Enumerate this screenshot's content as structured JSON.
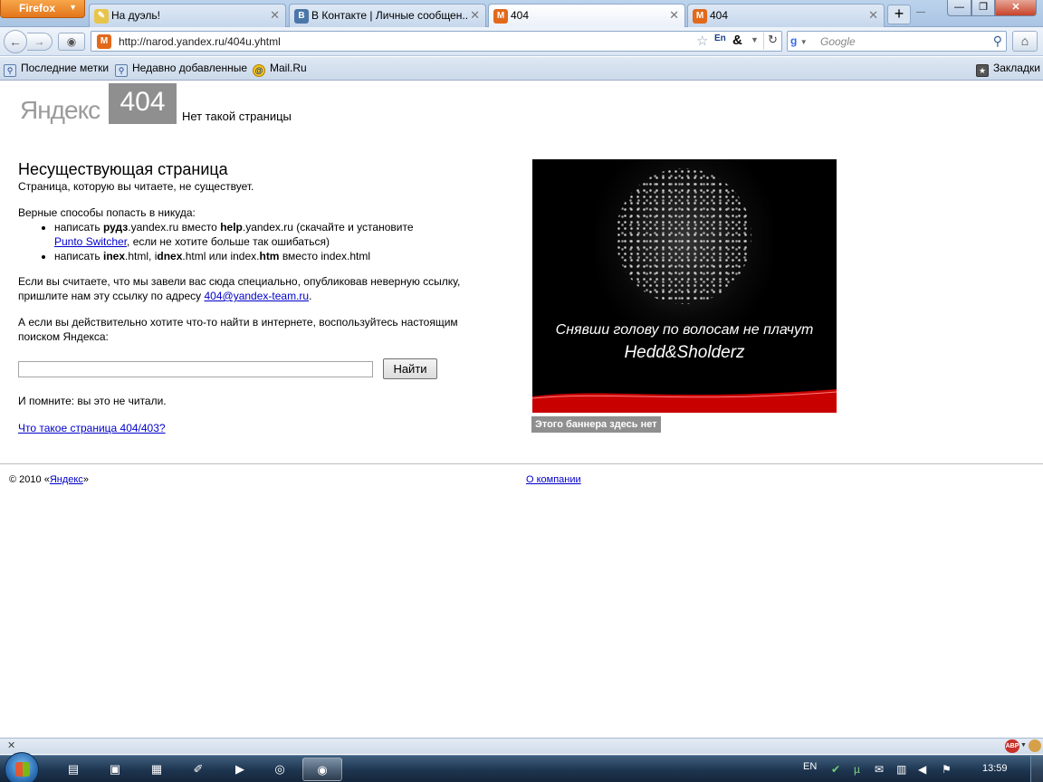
{
  "browser": {
    "menu_button": "Firefox",
    "tabs": [
      {
        "title": "На дуэль!",
        "favicon": "duel-favicon"
      },
      {
        "title": "В Контакте | Личные сообщен...",
        "favicon": "vk-favicon"
      },
      {
        "title": "404",
        "favicon": "narod-favicon",
        "active": true
      },
      {
        "title": "404",
        "favicon": "narod-favicon"
      }
    ],
    "url": "http://narod.yandex.ru/404u.yhtml",
    "search_engine": "google",
    "search_placeholder": "Google",
    "bookmarks": [
      "Последние метки",
      "Недавно добавленные",
      "Mail.Ru"
    ],
    "bookmarks_menu": "Закладки"
  },
  "page": {
    "logo": "Яндекс",
    "error_code": "404",
    "error_text": "Нет такой страницы",
    "heading": "Несуществующая страница",
    "subheading": "Страница, которую вы читаете, не существует.",
    "ways_heading": "Верные способы попасть в никуда:",
    "way1": {
      "before": "написать ",
      "bold1": "рудз",
      "mid": ".yandex.ru вместо ",
      "bold2": "help",
      "after": ".yandex.ru (скачайте и установите",
      "link": "Punto Switcher",
      "tail": ", если не хотите больше так ошибаться)"
    },
    "way2": {
      "before": "написать ",
      "bold1": "inex",
      "mid1": ".html, i",
      "bold2": "dnex",
      "mid2": ".html или index.",
      "bold3": "htm",
      "after": " вместо index.html"
    },
    "special_line1": "Если вы считаете, что мы завели вас сюда специально, опубликовав неверную ссылку,",
    "special_line2": "пришлите нам эту ссылку по адресу ",
    "special_email": "404@yandex-team.ru",
    "special_end": ".",
    "search_line1": "А если вы действительно хотите что-то найти в интернете, воспользуйтесь настоящим",
    "search_line2": "поиском Яндекса:",
    "search_button": "Найти",
    "search_value": "",
    "remember": "И помните: вы это не читали.",
    "what_link": "Что такое страница 404/403?",
    "banner": {
      "line1": "Снявши голову по волосам не плачут",
      "line2": "Hedd&Sholderz",
      "caption": "Этого баннера здесь нет",
      "wave_color": "#c80000"
    },
    "footer": {
      "copyright_prefix": "© 2010 «",
      "copyright_link": "Яндекс",
      "copyright_suffix": "»",
      "about": "О компании"
    }
  },
  "taskbar": {
    "language": "EN",
    "clock": "13:59",
    "apps": [
      "folder-icon",
      "save-icon",
      "calculator-icon",
      "paint-icon",
      "media-player-icon",
      "opera-icon",
      "firefox-icon"
    ]
  },
  "colors": {
    "link": "#0000cc",
    "logo_gray": "#9b9b9b",
    "badge_gray": "#8f8f8f"
  }
}
